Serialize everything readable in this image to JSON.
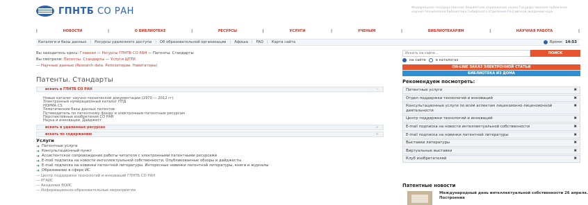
{
  "header": {
    "logo_bold": "ГПНТБ",
    "logo_light": "СО РАН",
    "note": "Федеральное государственное бюджетное учреждение науки Государственная публичная научно-техническая библиотека Сибирского отделения Российской академии наук"
  },
  "topnav": [
    "НОВОСТИ",
    "О БИБЛИОТЕКЕ",
    "РЕСУРСЫ",
    "УСЛУГИ",
    "УЧЕНЫМ",
    "БИБЛИОТЕКАРЯМ",
    "НАУЧНАЯ РАБОТА"
  ],
  "subnav": [
    "Каталоги и базы данных",
    "Ресурсы удаленного доступа",
    "Об образовательной организации",
    "Афиша",
    "FAQ",
    "Карта сайта"
  ],
  "clock": {
    "label": "Время:",
    "time": "14:53"
  },
  "breadcrumbs": {
    "here_label": "Вы находитесь здесь:",
    "here_links": [
      "Главная",
      "Ресурсы ГПНТБ СО РАН",
      "Патенты. Стандарты"
    ],
    "viewed_label": "Вы смотрели:",
    "viewed_links": [
      "Патенты. Стандарты",
      "Услуги ЦПТИ"
    ],
    "third_line": "Научные данные (Research data. Репозитории. Навигаторы)"
  },
  "page_title": "Патенты. Стандарты",
  "accordion": [
    {
      "label": "искать в ГПНТБ СО РАН",
      "toggle": "−"
    },
    {
      "label": "искать в удаленных ресурсах",
      "toggle": "+"
    },
    {
      "label": "искать по содержанию",
      "toggle": "+"
    }
  ],
  "accordion_items": [
    "Новые каталог научно-технической документации (1970 — 2012 гг)",
    "Электронный нумерационный каталог НТД",
    "НОРМА CS",
    "Тематические базы данных патентов",
    "Путеводитель по патентному фонду и электронным патентным ресурсам",
    "Перспективные изобретения СО РАН",
    "Наука и инновации. Дайджест"
  ],
  "services": {
    "title": "Услуги",
    "items": [
      "Патентные услуги",
      "Консультационный пункт",
      "Ассистентское сопровождение работы читателя с электронными патентными ресурсами",
      "E-mail подписка на новости интеллектуальной собственности. Опубликованные обзоры и дайджесты",
      "E-mail подписка на новинки патентной литературы. Интересные новинки патентной литературы, книги и журналы",
      "Образование в сфере ИС"
    ],
    "subitems": [
      "— Центр поддержки технологий и инноваций ГПНТБ СО РАН",
      "— РГАИС",
      "— Академия ВОИС",
      "— Информационно-образовательные мероприятия"
    ]
  },
  "search": {
    "placeholder": "Искать на сайте...",
    "button": "ПОИСК",
    "opt_site": "на сайте",
    "opt_catalog": "в каталогах"
  },
  "buttons": {
    "order": "ON-LINE ЗАКАЗ ЭЛЕКТРОННОЙ СТАТЬИ",
    "home": "БИБЛИОТЕКА ИЗ ДОМА"
  },
  "recommend": {
    "title": "Рекомендуем посмотреть:",
    "items": [
      "Патентные услуги",
      "Отдел поддержки технологий и инноваций",
      "Консультационные услуги по всем аспектам лицензионно-лицензионной деятельности",
      "Центр поддержки технологий и инноваций",
      "E-mail подписка на новости интеллектуальной собственности",
      "E-mail подписка на новинки патентной литературы",
      "Выставки литературы",
      "Виртуальные выставки",
      "Клуб изобретателей"
    ],
    "close": "✖"
  },
  "news": {
    "title": "Патентные новости",
    "text": "Международный день интеллектуальной собственности 26 апреля. Построения"
  }
}
